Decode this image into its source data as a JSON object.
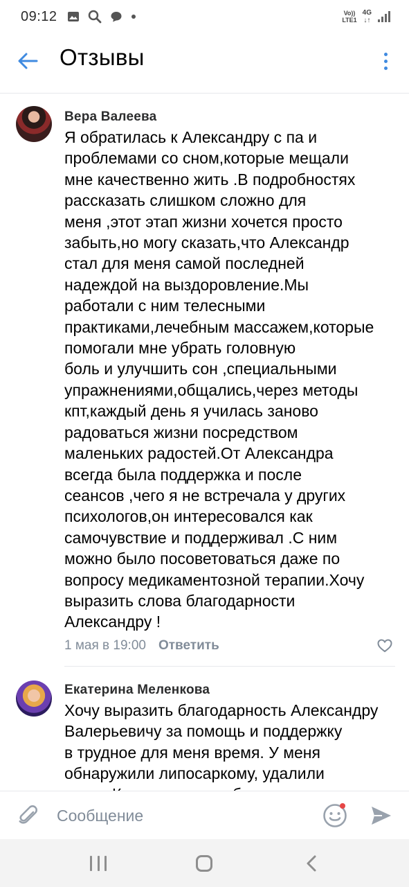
{
  "status_bar": {
    "time": "09:12",
    "network_top": "Vo))",
    "network_bottom": "LTE1",
    "network_type": "4G",
    "icons": [
      "gallery-icon",
      "search-icon",
      "chat-bubble-icon",
      "dot-icon",
      "signal-icon"
    ]
  },
  "app_bar": {
    "title": "Отзывы",
    "back_icon": "arrow-left-icon",
    "more_icon": "more-vertical-icon",
    "accent_color": "#3f8ae0"
  },
  "comments": [
    {
      "author": "Вера Валеева",
      "lines": [
        "Я обратилась к Александру с па и",
        "проблемами со сном,которые мещали",
        "мне качественно жить .В подробностях",
        "рассказать слишком сложно для",
        "меня ,этот этап жизни хочется просто",
        "забыть,но могу сказать,что Александр",
        "стал для меня самой последней",
        "надеждой на выздоровление.Мы",
        "работали с ним телесными",
        "практиками,лечебным массажем,которые",
        "помогали мне убрать головную",
        "боль и улучшить сон ,специальными",
        "упражнениями,общались,через  методы",
        "кпт,каждый день я училась заново",
        "радоваться жизни посредством",
        "маленьких радостей.От Александра",
        "всегда была поддержка и после",
        "сеансов ,чего я не встречала у других",
        "психологов,он интересовался как",
        "самочувствие и поддерживал .С ним",
        "можно было посоветоваться даже по",
        "вопросу медикаментозной терапии.Хочу",
        "выразить слова благодарности",
        "Александру !"
      ],
      "date": "1 мая в 19:00",
      "reply_label": "Ответить"
    },
    {
      "author": "Екатерина Меленкова",
      "lines": [
        "Хочу выразить благодарность Александру",
        "Валерьевичу за помощь и поддержку",
        "в трудное для меня время. У меня",
        "обнаружили липосаркому, удалили",
        "почку. Когда я к нему обратилась"
      ]
    }
  ],
  "composer": {
    "placeholder": "Сообщение",
    "attach_icon": "paperclip-icon",
    "emoji_icon": "smiley-icon",
    "send_icon": "send-icon"
  },
  "nav_bar": {
    "icons": [
      "recent-apps-icon",
      "home-icon",
      "back-icon"
    ]
  },
  "colors": {
    "accent": "#3f8ae0",
    "secondary_text": "#818c99",
    "author_text": "#2c2d2e",
    "notification_dot": "#e64646"
  }
}
